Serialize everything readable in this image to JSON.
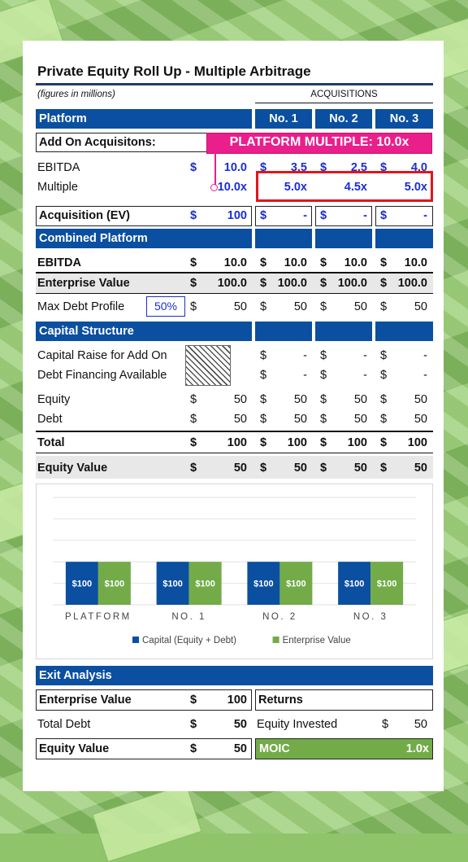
{
  "title": "Private Equity Roll Up - Multiple Arbitrage",
  "note": "(figures in millions)",
  "acquisitions_label": "ACQUISITIONS",
  "platform_header": "Platform",
  "col_headers": [
    "No. 1",
    "No. 2",
    "No. 3"
  ],
  "add_on_label": "Add On Acquisitons:",
  "callout": "PLATFORM MULTIPLE: 10.0x",
  "ebitda_row": {
    "label": "EBITDA",
    "cur": "$",
    "platform": "10.0",
    "acq": [
      "3.5",
      "2.5",
      "4.0"
    ]
  },
  "multiple_row": {
    "label": "Multiple",
    "platform": "10.0x",
    "acq": [
      "5.0x",
      "4.5x",
      "5.0x"
    ]
  },
  "acq_ev_row": {
    "label": "Acquisition (EV)",
    "cur": "$",
    "platform": "100",
    "acq": [
      "-",
      "-",
      "-"
    ]
  },
  "combined_header": "Combined Platform",
  "combined_ebitda": {
    "label": "EBITDA",
    "cur": "$",
    "platform": "10.0",
    "acq": [
      "10.0",
      "10.0",
      "10.0"
    ]
  },
  "combined_ev": {
    "label": "Enterprise Value",
    "cur": "$",
    "platform": "100.0",
    "acq": [
      "100.0",
      "100.0",
      "100.0"
    ]
  },
  "max_debt": {
    "label": "Max Debt Profile",
    "pct": "50%",
    "cur": "$",
    "platform": "50",
    "acq": [
      "50",
      "50",
      "50"
    ]
  },
  "capital_header": "Capital Structure",
  "capital_raise": {
    "label": "Capital Raise for Add On",
    "acq": [
      "-",
      "-",
      "-"
    ]
  },
  "debt_financing": {
    "label": "Debt Financing Available",
    "acq": [
      "-",
      "-",
      "-"
    ]
  },
  "equity_row": {
    "label": "Equity",
    "cur": "$",
    "platform": "50",
    "acq": [
      "50",
      "50",
      "50"
    ]
  },
  "debt_row": {
    "label": "Debt",
    "cur": "$",
    "platform": "50",
    "acq": [
      "50",
      "50",
      "50"
    ]
  },
  "total_row": {
    "label": "Total",
    "cur": "$",
    "platform": "100",
    "acq": [
      "100",
      "100",
      "100"
    ]
  },
  "equity_value_row": {
    "label": "Equity Value",
    "cur": "$",
    "platform": "50",
    "acq": [
      "50",
      "50",
      "50"
    ]
  },
  "chart_data": {
    "type": "bar",
    "categories": [
      "PLATFORM",
      "NO. 1",
      "NO. 2",
      "NO. 3"
    ],
    "series": [
      {
        "name": "Capital (Equity + Debt)",
        "values": [
          100,
          100,
          100,
          100
        ],
        "color": "#0b4fa0"
      },
      {
        "name": "Enterprise Value",
        "values": [
          100,
          100,
          100,
          100
        ],
        "color": "#72ab48"
      }
    ],
    "data_labels": [
      "$100",
      "$100",
      "$100",
      "$100",
      "$100",
      "$100",
      "$100",
      "$100"
    ],
    "ylim": [
      0,
      250
    ],
    "grid": true,
    "legend": "bottom"
  },
  "exit_header": "Exit Analysis",
  "exit_ev": {
    "label": "Enterprise Value",
    "cur": "$",
    "value": "100"
  },
  "returns_label": "Returns",
  "total_debt": {
    "label": "Total Debt",
    "cur": "$",
    "value": "50"
  },
  "equity_invested": {
    "label": "Equity Invested",
    "cur": "$",
    "value": "50"
  },
  "exit_equity": {
    "label": "Equity Value",
    "cur": "$",
    "value": "50"
  },
  "moic": {
    "label": "MOIC",
    "value": "1.0x"
  },
  "colors": {
    "header_blue": "#0b4fa0",
    "input_blue": "#1a2fd0",
    "callout_pink": "#ea1f8c",
    "highlight_red": "#e4141c",
    "green": "#72ab48"
  }
}
